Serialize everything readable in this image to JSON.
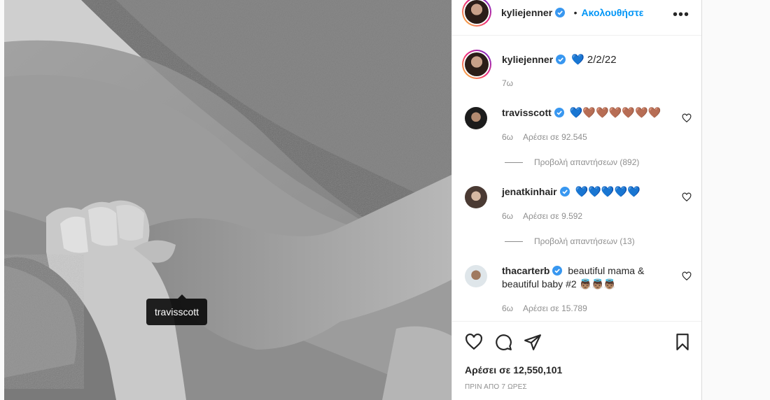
{
  "post": {
    "tag_label": "travisscott"
  },
  "header": {
    "username": "kyliejenner",
    "separator": "•",
    "follow_label": "Ακολουθήστε",
    "more_label": "•••"
  },
  "caption": {
    "username": "kyliejenner",
    "text": "💙 2/2/22",
    "age": "7ω"
  },
  "comments": [
    {
      "username": "travisscott",
      "text": "💙🤎🤎🤎🤎🤎🤎",
      "age": "6ω",
      "likes": "Αρέσει σε 92.545",
      "replies": "Προβολή απαντήσεων (892)"
    },
    {
      "username": "jenatkinhair",
      "text": "💙💙💙💙💙",
      "age": "6ω",
      "likes": "Αρέσει σε 9.592",
      "replies": "Προβολή απαντήσεων (13)"
    },
    {
      "username": "thacarterb",
      "text": "beautiful mama & beautiful baby #2 👼🏽👼🏽👼🏽",
      "age": "6ω",
      "likes": "Αρέσει σε 15.789"
    }
  ],
  "footer": {
    "likes": "Αρέσει σε 12,550,101",
    "timestamp": "ΠΡΙΝ ΑΠΟ 7 ΩΡΕΣ"
  },
  "colors": {
    "accent": "#0095f6",
    "verified": "#3897f0",
    "muted": "#8e8e8e"
  }
}
